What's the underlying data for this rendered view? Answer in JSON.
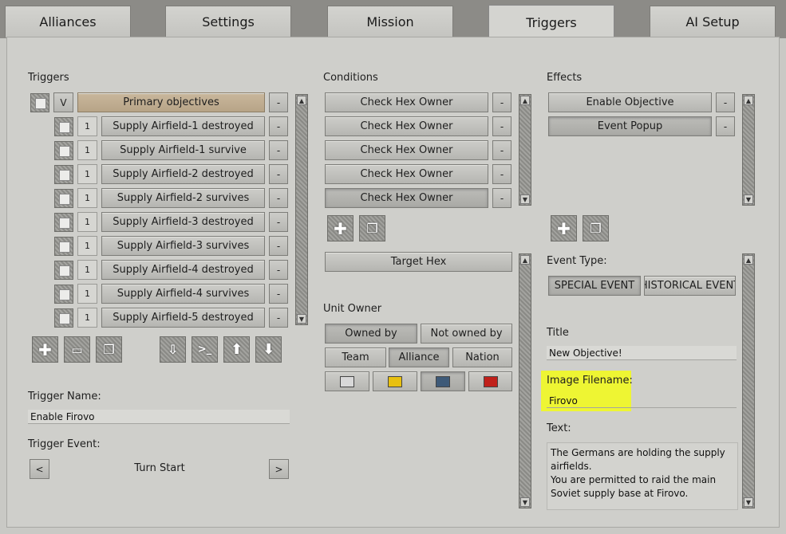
{
  "tabs": [
    "Alliances",
    "Settings",
    "Mission",
    "Triggers",
    "AI Setup"
  ],
  "active_tab": "Triggers",
  "triggers": {
    "heading": "Triggers",
    "header_row": {
      "v_label": "V",
      "label": "Primary objectives",
      "delete_label": "-"
    },
    "items": [
      {
        "num": "1",
        "label": "Supply Airfield-1 destroyed",
        "delete_label": "-"
      },
      {
        "num": "1",
        "label": "Supply Airfield-1 survive",
        "delete_label": "-"
      },
      {
        "num": "1",
        "label": "Supply Airfield-2 destroyed",
        "delete_label": "-"
      },
      {
        "num": "1",
        "label": "Supply Airfield-2 survives",
        "delete_label": "-"
      },
      {
        "num": "1",
        "label": "Supply Airfield-3 destroyed",
        "delete_label": "-"
      },
      {
        "num": "1",
        "label": "Supply Airfield-3 survives",
        "delete_label": "-"
      },
      {
        "num": "1",
        "label": "Supply Airfield-4 destroyed",
        "delete_label": "-"
      },
      {
        "num": "1",
        "label": "Supply Airfield-4 survives",
        "delete_label": "-"
      },
      {
        "num": "1",
        "label": "Supply Airfield-5 destroyed",
        "delete_label": "-"
      }
    ],
    "name_label": "Trigger Name:",
    "name_value": "Enable Firovo",
    "event_label": "Trigger Event:",
    "event_value": "Turn Start",
    "prev_label": "<",
    "next_label": ">"
  },
  "conditions": {
    "heading": "Conditions",
    "items": [
      {
        "label": "Check Hex Owner",
        "delete_label": "-"
      },
      {
        "label": "Check Hex Owner",
        "delete_label": "-"
      },
      {
        "label": "Check Hex Owner",
        "delete_label": "-"
      },
      {
        "label": "Check Hex Owner",
        "delete_label": "-"
      },
      {
        "label": "Check Hex Owner",
        "delete_label": "-"
      }
    ],
    "target_hex_label": "Target Hex",
    "unit_owner_label": "Unit Owner",
    "owned_by": "Owned by",
    "not_owned_by": "Not owned by",
    "team": "Team",
    "alliance": "Alliance",
    "nation": "Nation",
    "colors": [
      "#d8d8d8",
      "#e8c010",
      "#3e5a78",
      "#c0201a"
    ]
  },
  "effects": {
    "heading": "Effects",
    "items": [
      {
        "label": "Enable Objective",
        "delete_label": "-"
      },
      {
        "label": "Event Popup",
        "delete_label": "-"
      }
    ],
    "event_type_label": "Event Type:",
    "special_event": "SPECIAL EVENT",
    "historical_event": "HISTORICAL EVENT",
    "title_label": "Title",
    "title_value": "New Objective!",
    "image_label": "Image Filename:",
    "image_value": "Firovo",
    "text_label": "Text:",
    "text_lines": [
      "The Germans are holding the supply",
      "airfields.",
      "You are permitted to raid the main",
      "Soviet supply base at Firovo."
    ]
  },
  "highlight_color": "#eef533"
}
